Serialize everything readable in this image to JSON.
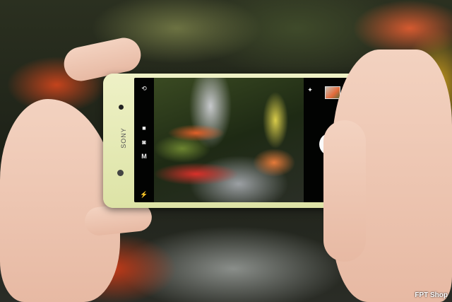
{
  "phone": {
    "brand": "SONY"
  },
  "camera_ui": {
    "left_icons": [
      "camera-switch-icon",
      "video-icon",
      "camera-icon",
      "manual-mode-icon",
      "flash-icon"
    ],
    "mode_label": "M",
    "right_icons": [
      "effects-icon",
      "gallery-thumbnail",
      "shutter-button",
      "settings-icon"
    ]
  },
  "watermark": "FPT Shop"
}
